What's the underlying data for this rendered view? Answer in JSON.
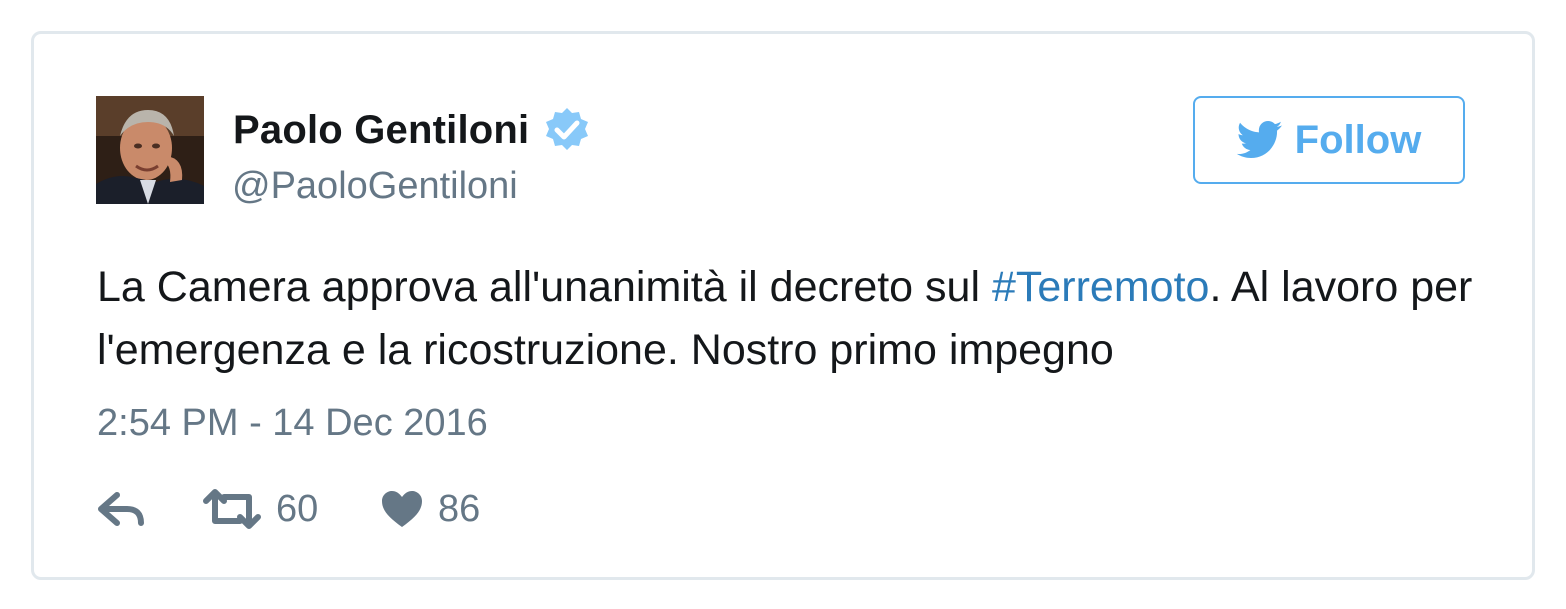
{
  "colors": {
    "accent": "#55acee",
    "link": "#2b7bb9",
    "secondary_text": "#657786",
    "border": "#e1e8ed",
    "verified": "#88c9f9"
  },
  "user": {
    "name": "Paolo Gentiloni",
    "handle": "@PaoloGentiloni",
    "verified": true,
    "verified_icon": "verified-badge-icon"
  },
  "follow_button": {
    "label": "Follow",
    "icon": "twitter-bird-icon"
  },
  "tweet": {
    "text_before": "La Camera approva all'unanimità il decreto sul ",
    "hashtag": "#Terremoto",
    "text_after": ". Al lavoro per l'emergenza e la ricostruzione. Nostro primo impegno",
    "timestamp": "2:54 PM - 14 Dec 2016"
  },
  "actions": {
    "reply_icon": "reply-icon",
    "retweet_icon": "retweet-icon",
    "retweet_count": "60",
    "like_icon": "heart-icon",
    "like_count": "86"
  }
}
